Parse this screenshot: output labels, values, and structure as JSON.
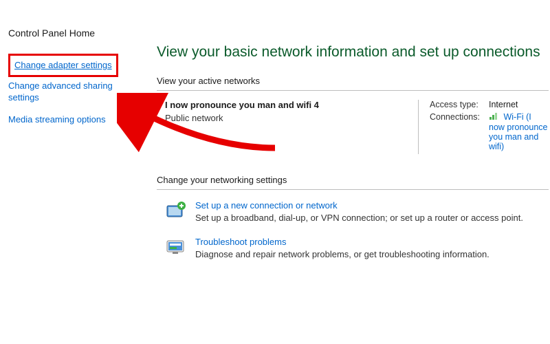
{
  "sidebar": {
    "home": "Control Panel Home",
    "items": [
      {
        "label": "Change adapter settings",
        "highlighted": true
      },
      {
        "label": "Change advanced sharing settings",
        "highlighted": false
      },
      {
        "label": "Media streaming options",
        "highlighted": false
      }
    ]
  },
  "main": {
    "title": "View your basic network information and set up connections",
    "active_section": "View your active networks",
    "network": {
      "name": "I now pronounce you man and wifi 4",
      "type": "Public network",
      "access_type_label": "Access type:",
      "access_type_value": "Internet",
      "connections_label": "Connections:",
      "connections_value": "Wi-Fi (I now pronounce you man and wifi)"
    },
    "settings_section": "Change your networking settings",
    "settings": [
      {
        "title": "Set up a new connection or network",
        "desc": "Set up a broadband, dial-up, or VPN connection; or set up a router or access point."
      },
      {
        "title": "Troubleshoot problems",
        "desc": "Diagnose and repair network problems, or get troubleshooting information."
      }
    ]
  }
}
